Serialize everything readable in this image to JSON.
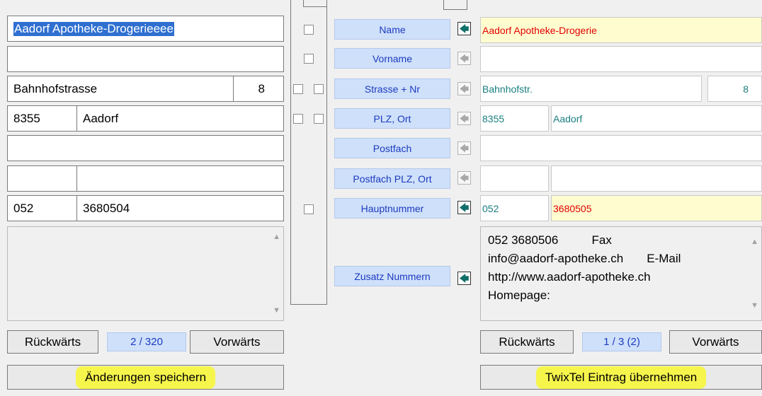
{
  "left": {
    "name_value": "Aadorf Apotheke-Drogerieeee",
    "vorname_value": "",
    "strasse_value": "Bahnhofstrasse",
    "nr_value": "8",
    "plz_value": "8355",
    "ort_value": "Aadorf",
    "postfach_value": "",
    "postfach_plz_value": "",
    "postfach_ort_value": "",
    "vorwahl_value": "052",
    "nummer_value": "3680504",
    "back_label": "Rückwärts",
    "counter": "2 / 320",
    "forward_label": "Vorwärts",
    "save_label": "Änderungen speichern"
  },
  "labels": {
    "name": "Name",
    "vorname": "Vorname",
    "strasse": "Strasse + Nr",
    "plz_ort": "PLZ, Ort",
    "postfach": "Postfach",
    "postfach_plz_ort": "Postfach PLZ, Ort",
    "hauptnummer": "Hauptnummer",
    "zusatz": "Zusatz Nummern"
  },
  "right": {
    "name_value": "Aadorf Apotheke-Drogerie",
    "vorname_value": "",
    "strasse_value": "Bahnhofstr.",
    "nr_value": "8",
    "plz_value": "8355",
    "ort_value": "Aadorf",
    "postfach_value": "",
    "postfach_plz_value": "",
    "postfach_ort_value": "",
    "vorwahl_value": "052",
    "nummer_value": "3680505",
    "zusatz_lines": [
      "052 3680506          Fax",
      "info@aadorf-apotheke.ch       E-Mail",
      "http://www.aadorf-apotheke.ch",
      "Homepage:"
    ],
    "back_label": "Rückwärts",
    "counter": "1 / 3 (2)",
    "forward_label": "Vorwärts",
    "accept_label": "TwixTel Eintrag übernehmen"
  },
  "icons": {
    "arrow_glyph": "🡄",
    "scroll_up": "▲",
    "scroll_down": "▼"
  }
}
